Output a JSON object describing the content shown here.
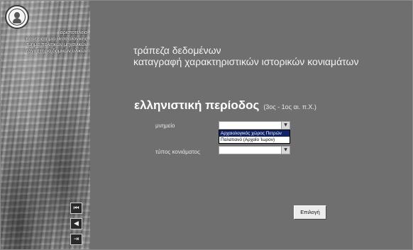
{
  "sidebar": {
    "logo_icon": "university-seal-icon",
    "institution_lines": [
      "αριστοτέλειο",
      "πανεπιστήμιο θεσσαλονίκης",
      "τμήμα πολιτικών μηχανικών",
      "εργαστήριο δομικών υλικών"
    ],
    "nav": [
      {
        "icon": "first-record-icon",
        "glyph": "⏮"
      },
      {
        "icon": "back-icon",
        "glyph": "◀"
      },
      {
        "icon": "exit-icon",
        "glyph": "⇥"
      }
    ]
  },
  "header": {
    "line1": "τράπεζα δεδομένων",
    "line2": "καταγραφή χαρακτηριστικών ιστορικών κονιαμάτων"
  },
  "period": {
    "title": "ελληνιστική περίοδος",
    "range": "(3ος - 1ος αι. π.Χ.)"
  },
  "form": {
    "monument_label": "μνημείο",
    "monument_value": "",
    "monument_options": [
      "Αρχαιολογικός χώρος Πετρών",
      "Παλατιανό (Αρχαίο Ίωρον)"
    ],
    "mortar_type_label": "τύπος κονιάματος",
    "mortar_type_value": ""
  },
  "actions": {
    "select_label": "Επιλογή"
  },
  "colors": {
    "background": "#6f6f6f",
    "highlight": "#10246a"
  }
}
